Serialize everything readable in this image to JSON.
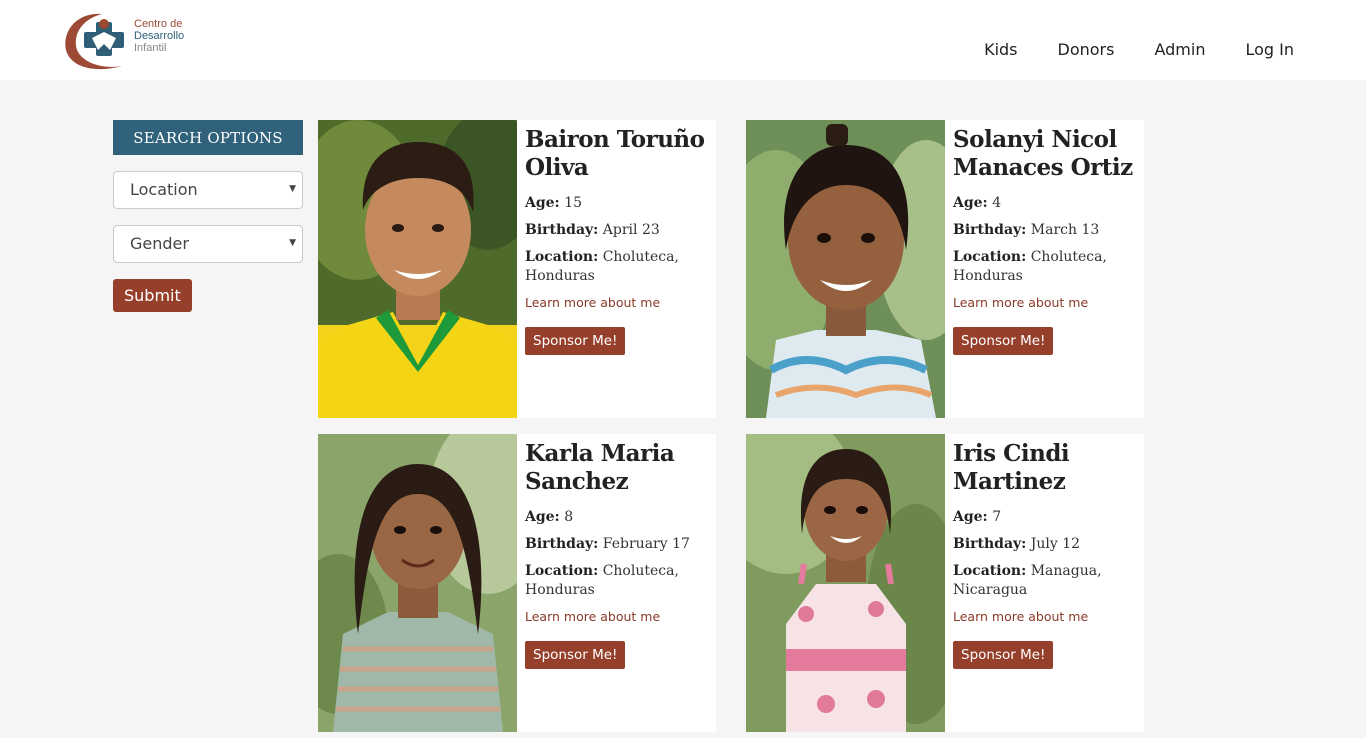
{
  "brand": {
    "line1": "Centro de",
    "line2": "Desarrollo",
    "line3": "Infantil"
  },
  "nav": {
    "items": [
      "Kids",
      "Donors",
      "Admin",
      "Log In"
    ]
  },
  "sidebar": {
    "header": "SEARCH OPTIONS",
    "location_select": "Location",
    "gender_select": "Gender",
    "submit_label": "Submit"
  },
  "labels": {
    "age": "Age:",
    "birthday": "Birthday:",
    "location": "Location:",
    "learn_more": "Learn more about me",
    "sponsor": "Sponsor Me!"
  },
  "kids": [
    {
      "name": "Bairon Toruño Oliva",
      "age": "15",
      "birthday": "April 23",
      "location": "Choluteca, Honduras"
    },
    {
      "name": "Solanyi Nicol Manaces Ortiz",
      "age": "4",
      "birthday": "March 13",
      "location": "Choluteca, Honduras"
    },
    {
      "name": "Karla Maria Sanchez",
      "age": "8",
      "birthday": "February 17",
      "location": "Choluteca, Honduras"
    },
    {
      "name": "Iris Cindi Martinez",
      "age": "7",
      "birthday": "July 12",
      "location": "Managua, Nicaragua"
    }
  ],
  "colors": {
    "accent": "#963f2b",
    "header_blue": "#30627c",
    "background": "#f5f5f5"
  }
}
